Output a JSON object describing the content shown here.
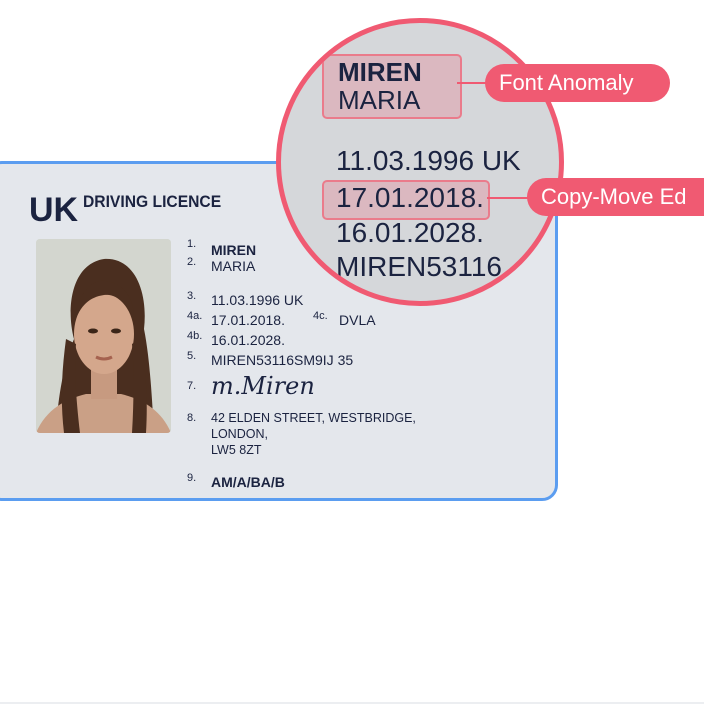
{
  "card": {
    "country": "UK",
    "title": "DRIVING LICENCE",
    "fields": [
      {
        "num": "1.",
        "value": "MIREN"
      },
      {
        "num": "2.",
        "value": "MARIA"
      },
      {
        "num": "3.",
        "value": "11.03.1996 UK"
      },
      {
        "num": "4a.",
        "value": "17.01.2018."
      },
      {
        "num": "4c.",
        "value": "DVLA"
      },
      {
        "num": "4b.",
        "value": "16.01.2028."
      },
      {
        "num": "5.",
        "value": "MIREN53116SM9IJ 35"
      },
      {
        "num": "7.",
        "value": "m.Miren"
      },
      {
        "num": "8.",
        "value": "42 ELDEN STREET, WESTBRIDGE,"
      },
      {
        "num": "",
        "value": "LONDON,"
      },
      {
        "num": "",
        "value": "LW5 8ZT"
      },
      {
        "num": "9.",
        "value": "AM/A/BA/B"
      }
    ]
  },
  "zoom": {
    "surname": "MIREN",
    "given": "MARIA",
    "dob": "11.03.1996 UK",
    "issue": "17.01.2018.",
    "expiry": "16.01.2028.",
    "number": "MIREN53116"
  },
  "tags": {
    "font": "Font Anomaly",
    "copymove": "Copy-Move Ed"
  },
  "colors": {
    "accent": "#f05a72",
    "card_border": "#5b9df0",
    "card_bg": "#e4e7ec",
    "text": "#1b2340"
  }
}
